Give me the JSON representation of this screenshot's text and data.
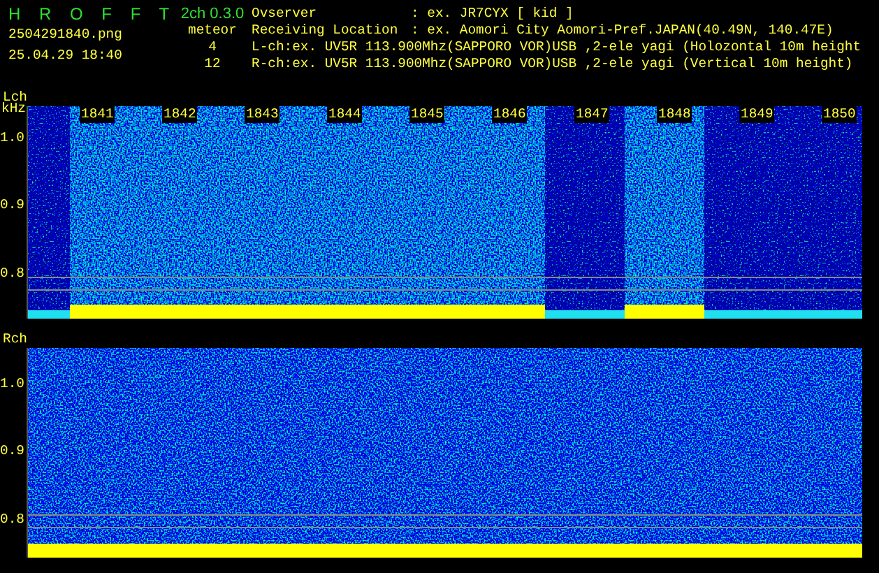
{
  "header": {
    "app_title": "H R O F F T",
    "version": "2ch 0.3.0",
    "file_name": "2504291840.png",
    "timestamp": "25.04.29 18:40",
    "count_label": "meteor",
    "lch_count": "4",
    "rch_count": "12",
    "info": [
      {
        "label": "Ovserver",
        "value": ": ex. JR7CYX [ kid ]"
      },
      {
        "label": "Receiving Location",
        "value": ": ex. Aomori City Aomori-Pref.JAPAN(40.49N, 140.47E)"
      }
    ],
    "channels": [
      "L-ch:ex. UV5R 113.900Mhz(SAPPORO VOR)USB ,2-ele yagi (Holozontal 10m height",
      "R-ch:ex. UV5R 113.900Mhz(SAPPORO VOR)USB ,2-ele yagi (Vertical 10m height)"
    ]
  },
  "lch": {
    "label": "Lch",
    "unit": "kHz",
    "yticks": [
      "1.0",
      "0.9",
      "0.8"
    ],
    "time_labels": [
      "1841",
      "1842",
      "1843",
      "1844",
      "1845",
      "1846",
      "1847",
      "1848",
      "1849",
      "1850"
    ],
    "segments": [
      {
        "active": false
      },
      {
        "active": true
      },
      {
        "active": true
      },
      {
        "active": true
      },
      {
        "active": true
      },
      {
        "active": true
      },
      {
        "active": true
      },
      {
        "active": false
      },
      {
        "active": true
      },
      {
        "active": false
      },
      {
        "active": false
      }
    ]
  },
  "rch": {
    "label": "Rch",
    "yticks": [
      "1.0",
      "0.9",
      "0.8"
    ]
  }
}
